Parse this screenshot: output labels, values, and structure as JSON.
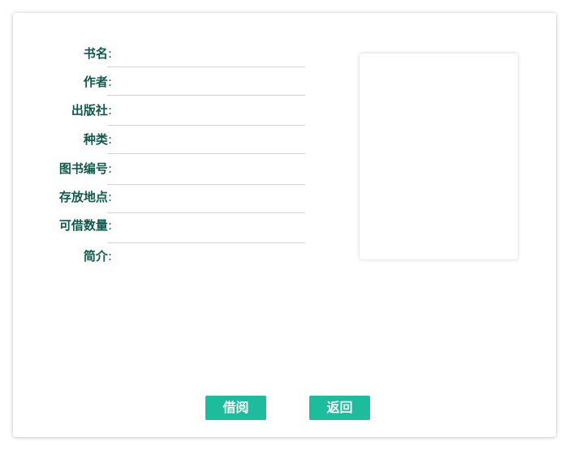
{
  "fields": [
    {
      "label": "书名",
      "colon": ":",
      "value": ""
    },
    {
      "label": "作者",
      "colon": ":",
      "value": ""
    },
    {
      "label": "出版社",
      "colon": ":",
      "value": ""
    },
    {
      "label": "种类",
      "colon": ":",
      "value": ""
    },
    {
      "label": "图书编号",
      "colon": ":",
      "value": ""
    },
    {
      "label": "存放地点",
      "colon": ":",
      "value": ""
    },
    {
      "label": "可借数量",
      "colon": ":",
      "value": ""
    },
    {
      "label": "简介",
      "colon": ":",
      "value": ""
    }
  ],
  "buttons": {
    "borrow_label": "借阅",
    "back_label": "返回"
  },
  "colors": {
    "label": "#0f5a4b",
    "button_bg": "#1cbc9c",
    "button_text": "#ffffff"
  }
}
